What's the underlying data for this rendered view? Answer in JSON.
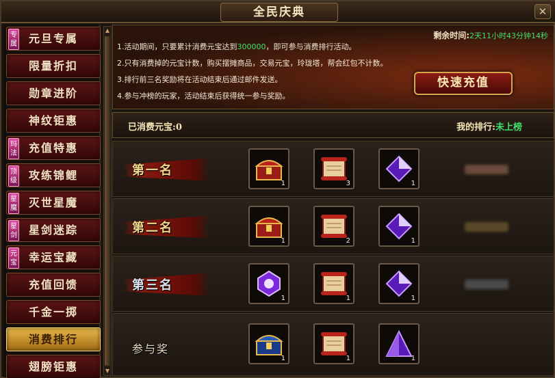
{
  "window": {
    "title": "全民庆典",
    "close_label": "✕"
  },
  "sidebar": {
    "items": [
      {
        "label": "元旦专属",
        "badge": "专属"
      },
      {
        "label": "限量折扣",
        "badge": ""
      },
      {
        "label": "勋章进阶",
        "badge": ""
      },
      {
        "label": "神纹钜惠",
        "badge": ""
      },
      {
        "label": "充值特惠",
        "badge": "玛法"
      },
      {
        "label": "攻练锦鲤",
        "badge": "顶级"
      },
      {
        "label": "灭世星魔",
        "badge": "星魔"
      },
      {
        "label": "星剑迷踪",
        "badge": "星剑"
      },
      {
        "label": "幸运宝藏",
        "badge": "元宝"
      },
      {
        "label": "充值回馈",
        "badge": ""
      },
      {
        "label": "千金一掷",
        "badge": ""
      },
      {
        "label": "消费排行",
        "badge": "",
        "active": true
      },
      {
        "label": "翅膀钜惠",
        "badge": ""
      }
    ]
  },
  "info": {
    "countdown_label": "剩余时间:",
    "countdown_value": "2天11小时43分钟14秒",
    "rule1_prefix": "1.活动期间，只要累计消费元宝达到",
    "rule1_amount": "300000",
    "rule1_suffix": "，即可参与消费排行活动。",
    "rule2": "2.只有消费掉的元宝计数，购买摆摊商品，交易元宝，玲珑塔，帮会红包不计数。",
    "rule3": "3.排行前三名奖励将在活动结束后通过邮件发送。",
    "rule4": "4.参与冲榜的玩家，活动结束后获得统一参与奖励。",
    "recharge_button": "快速充值"
  },
  "status": {
    "spent_label": "已消费元宝:",
    "spent_value": "0",
    "rank_label": "我的排行:",
    "rank_value": "未上榜"
  },
  "rows": [
    {
      "label": "第一名",
      "items": [
        {
          "icon": "treasure-chest-icon",
          "qty": "1"
        },
        {
          "icon": "scroll-icon",
          "qty": "3"
        },
        {
          "icon": "purple-crystal-icon",
          "qty": "1"
        }
      ],
      "blur_color": "#6a4a3a"
    },
    {
      "label": "第二名",
      "items": [
        {
          "icon": "treasure-chest-icon",
          "qty": "1"
        },
        {
          "icon": "scroll-icon",
          "qty": "2"
        },
        {
          "icon": "purple-crystal-icon",
          "qty": "1"
        }
      ],
      "blur_color": "#5a4a2a"
    },
    {
      "label": "第三名",
      "items": [
        {
          "icon": "violet-gem-icon",
          "qty": "1"
        },
        {
          "icon": "scroll-icon",
          "qty": "1"
        },
        {
          "icon": "purple-crystal-icon",
          "qty": "1"
        }
      ],
      "blur_color": "#4a4a4a"
    },
    {
      "label": "参与奖",
      "items": [
        {
          "icon": "blue-gold-chest-icon",
          "qty": "1"
        },
        {
          "icon": "scroll-icon",
          "qty": "1"
        },
        {
          "icon": "purple-triangle-icon",
          "qty": "1"
        }
      ]
    }
  ]
}
